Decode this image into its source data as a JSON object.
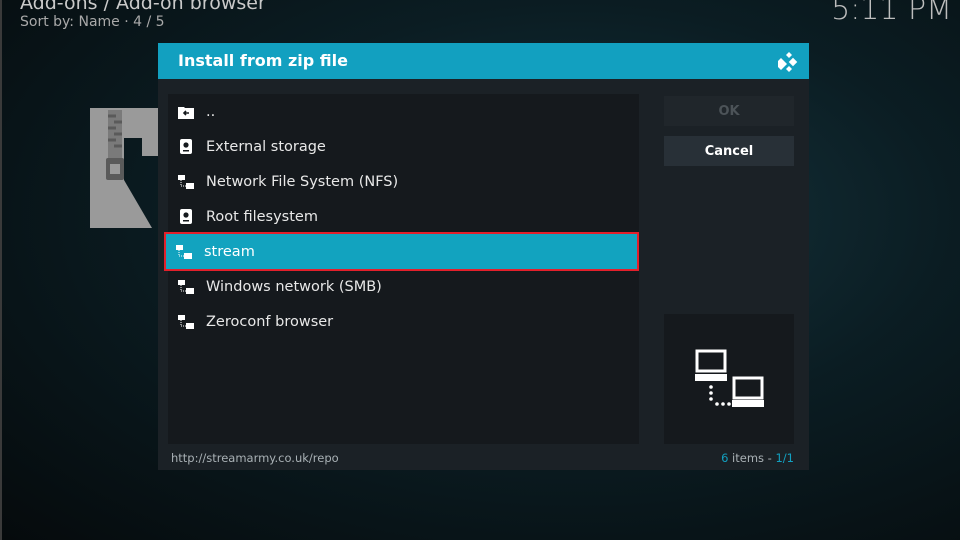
{
  "header": {
    "breadcrumb": "Add-ons / Add-on browser",
    "sort_info": "Sort by: Name  ·  4 / 5",
    "clock": "5:11 PM"
  },
  "dialog": {
    "title": "Install from zip file",
    "items": [
      {
        "label": "..",
        "icon": "folder-back-icon"
      },
      {
        "label": "External storage",
        "icon": "drive-icon"
      },
      {
        "label": "Network File System (NFS)",
        "icon": "network-icon"
      },
      {
        "label": "Root filesystem",
        "icon": "drive-icon"
      },
      {
        "label": "stream",
        "icon": "network-icon",
        "selected": true
      },
      {
        "label": "Windows network (SMB)",
        "icon": "network-icon"
      },
      {
        "label": "Zeroconf browser",
        "icon": "network-icon"
      }
    ],
    "buttons": {
      "ok": "OK",
      "cancel": "Cancel"
    },
    "footer": {
      "path": "http://streamarmy.co.uk/repo",
      "count_num": "6",
      "count_word": " items - ",
      "page": "1/1"
    }
  },
  "colors": {
    "accent": "#12a0c0",
    "highlight_border": "#e3202b",
    "dialog_bg": "#1b2126"
  }
}
